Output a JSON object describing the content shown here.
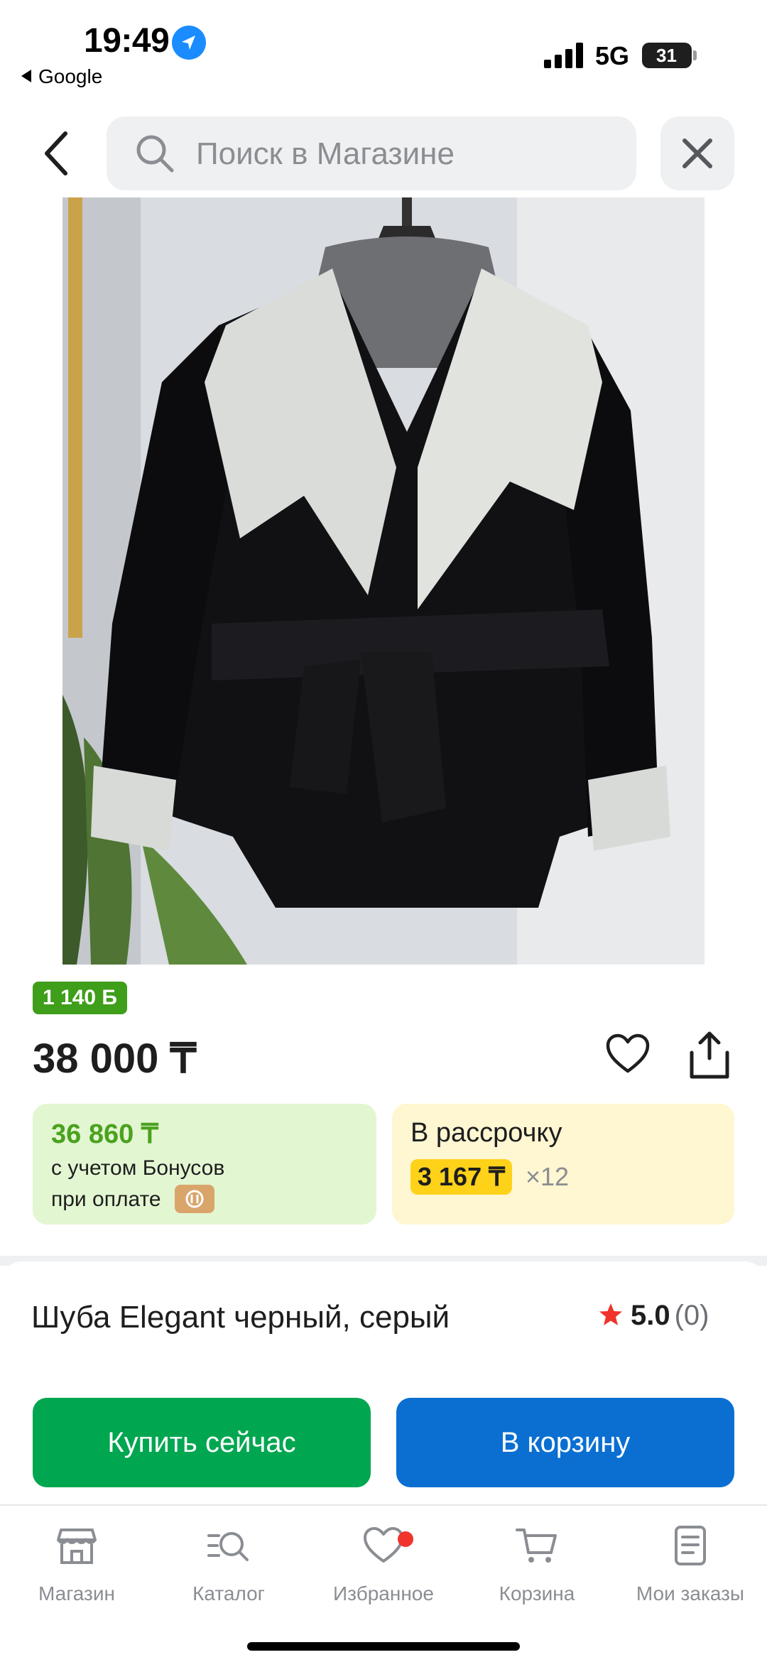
{
  "status_bar": {
    "time": "19:49",
    "back_app": "Google",
    "network": "5G",
    "battery": "31"
  },
  "header": {
    "search_placeholder": "Поиск в Магазине"
  },
  "product": {
    "bonus_points": "1 140 Б",
    "price": "38 000 ₸",
    "bonus_price": "36 860 ₸",
    "bonus_note_line1": "с учетом Бонусов",
    "bonus_note_line2": "при оплате",
    "installment_title": "В рассрочку",
    "installment_amount": "3 167 ₸",
    "installment_months": "×12",
    "title": "Шуба Elegant черный, серый",
    "rating_value": "5.0",
    "rating_count": "(0)"
  },
  "actions": {
    "buy_now": "Купить сейчас",
    "add_to_cart": "В корзину"
  },
  "bottom_nav": {
    "items": [
      {
        "label": "Магазин",
        "icon": "store-icon"
      },
      {
        "label": "Каталог",
        "icon": "catalog-search-icon"
      },
      {
        "label": "Избранное",
        "icon": "heart-icon"
      },
      {
        "label": "Корзина",
        "icon": "cart-icon"
      },
      {
        "label": "Мои заказы",
        "icon": "orders-icon"
      }
    ]
  },
  "colors": {
    "buy_button": "#00a650",
    "cart_button": "#0a6fd1",
    "bonus_green": "#4aa21e",
    "installment_yellow": "#ffd21a",
    "rating_star": "#f0332b",
    "favorite_dot": "#f0332b"
  }
}
